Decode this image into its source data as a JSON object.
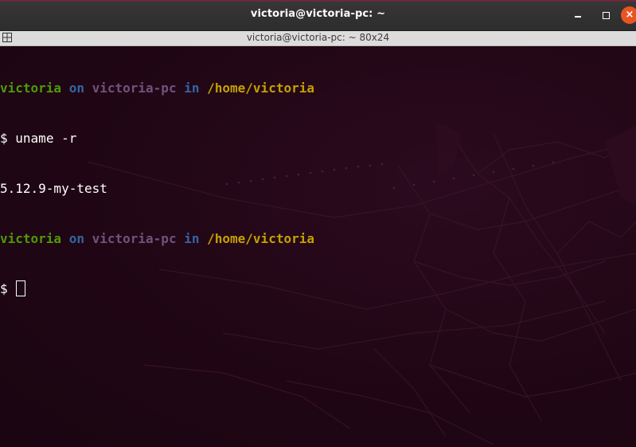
{
  "window": {
    "title": "victoria@victoria-pc: ~",
    "close_glyph": "×",
    "accent_color": "#e95420",
    "buttons": [
      "minimize-icon",
      "maximize-icon",
      "close-icon"
    ]
  },
  "tab": {
    "label": "victoria@victoria-pc: ~ 80x24",
    "icon": "tab-grid-icon"
  },
  "terminal": {
    "colors": {
      "user": "#4e9a06",
      "keyword": "#3465a4",
      "host": "#75507b",
      "path": "#c4a000",
      "background": "#220716"
    },
    "prompt1": {
      "user": "victoria",
      "on": "on",
      "host": "victoria-pc",
      "in": "in",
      "path": "/home/victoria"
    },
    "command1": {
      "symbol": "$",
      "text": "uname -r"
    },
    "output1": "5.12.9-my-test",
    "prompt2": {
      "user": "victoria",
      "on": "on",
      "host": "victoria-pc",
      "in": "in",
      "path": "/home/victoria"
    },
    "command2": {
      "symbol": "$",
      "text": ""
    }
  }
}
